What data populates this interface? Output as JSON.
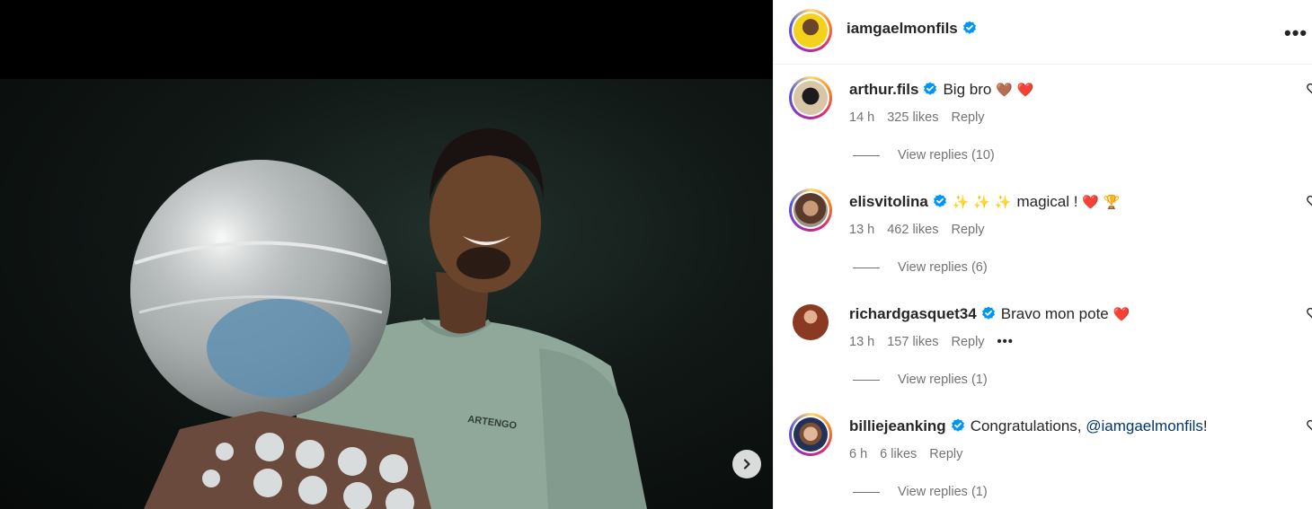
{
  "post": {
    "author": "iamgaelmonfils",
    "photo_shirt_text": "ARTENGO"
  },
  "icons": {
    "verified": "verified-badge-icon",
    "more": "more-options-icon",
    "next": "chevron-right-icon",
    "like": "heart-outline-icon"
  },
  "colors": {
    "verified_blue": "#0095f6",
    "mention": "#00376b",
    "meta_gray": "#737373"
  },
  "comments": [
    {
      "username": "arthur.fils",
      "text": "Big bro",
      "emojis": "🤎 ❤️",
      "time": "14 h",
      "likes": "325 likes",
      "reply_label": "Reply",
      "view_replies": "View replies (10)"
    },
    {
      "username": "elisvitolina",
      "text_prefix_emojis": "✨ ✨ ✨",
      "text": "magical !",
      "emojis": "❤️ 🏆",
      "time": "13 h",
      "likes": "462 likes",
      "reply_label": "Reply",
      "view_replies": "View replies (6)"
    },
    {
      "username": "richardgasquet34",
      "text": "Bravo mon pote",
      "emojis": "❤️",
      "time": "13 h",
      "likes": "157 likes",
      "reply_label": "Reply",
      "more_label": "•••",
      "view_replies": "View replies (1)"
    },
    {
      "username": "billiejeanking",
      "text": "Congratulations,",
      "mention": "@iamgaelmonfils",
      "text_suffix": "!",
      "time": "6 h",
      "likes": "6 likes",
      "reply_label": "Reply",
      "view_replies": "View replies (1)"
    }
  ],
  "header_more_label": "•••"
}
